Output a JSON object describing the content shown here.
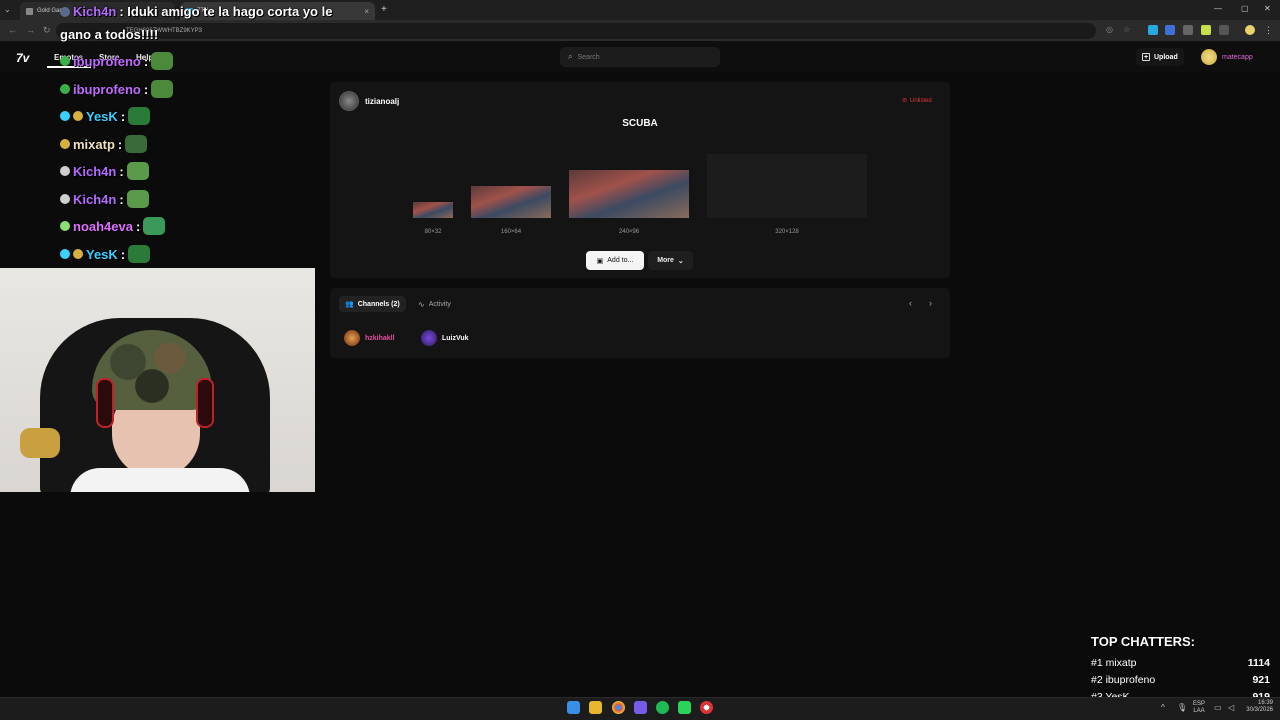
{
  "browser": {
    "tabs": [
      {
        "label": "Gold Gam"
      },
      {
        "label": "7TV"
      }
    ],
    "url": "TEGH606ZWWHTBZ9KYP3"
  },
  "nav": {
    "links": [
      "Emotes",
      "Store",
      "Help"
    ],
    "search_placeholder": "Search",
    "upload_label": "Upload",
    "username": "matecapp"
  },
  "emote": {
    "author": "tizianoalj",
    "status": "Unlisted",
    "name": "SCUBA",
    "sizes": [
      "80×32",
      "160×64",
      "240×96",
      "320×128"
    ],
    "add_label": "Add to...",
    "more_label": "More"
  },
  "tabs": {
    "channels": "Channels (2)",
    "activity": "Activity"
  },
  "channels": [
    {
      "name": "hzkihakll",
      "color": "#e04fa0"
    },
    {
      "name": "LuizVuk",
      "color": "#ffffff"
    }
  ],
  "chat": [
    {
      "user": "Kich4n",
      "message": ": Iduki amigo te la hago corta yo le",
      "color": "#b36bff"
    },
    {
      "user": "",
      "message": "gano a todos!!!!",
      "color": "#ffffff"
    },
    {
      "user": "ibuprofeno",
      "message": ":",
      "color": "#c06bff"
    },
    {
      "user": "ibuprofeno",
      "message": ":",
      "color": "#c06bff"
    },
    {
      "user": "YesK",
      "message": ":",
      "color": "#3ad0ff"
    },
    {
      "user": "mixatp",
      "message": ":",
      "color": "#f0e0c0"
    },
    {
      "user": "Kich4n",
      "message": ":",
      "color": "#b36bff"
    },
    {
      "user": "Kich4n",
      "message": ":",
      "color": "#b36bff"
    },
    {
      "user": "noah4eva",
      "message": ":",
      "color": "#e070ff"
    },
    {
      "user": "YesK",
      "message": ":",
      "color": "#3ad0ff"
    }
  ],
  "top_chatters": {
    "title": "TOP CHATTERS:",
    "rows": [
      {
        "rank": "#1 mixatp",
        "score": "1114"
      },
      {
        "rank": "#2 ibuprofeno",
        "score": "921"
      },
      {
        "rank": "#3 YesK",
        "score": "919"
      }
    ]
  },
  "taskbar": {
    "lang": "ESP",
    "lang2": "LAA",
    "time": "16:39",
    "date": "30/3/2026"
  },
  "colors": {
    "accent_pink": "#e06ad8",
    "unlisted_red": "#e03a3a"
  }
}
